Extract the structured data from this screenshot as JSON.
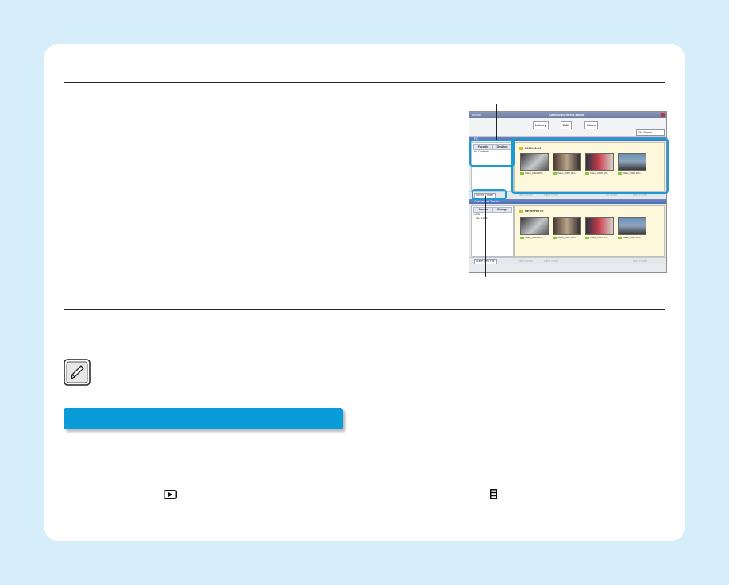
{
  "app": {
    "title_left": "MENU",
    "title_center": "SAMSUNG Intelli-studio",
    "toolbar": {
      "library_label": "Library",
      "edit_label": "Edit",
      "share_label": "Share",
      "sort_option": "File Name"
    },
    "pc_panel": {
      "header": "PC",
      "tabs": [
        "Favorite",
        "Desktop"
      ],
      "tree_item": "All Contents",
      "folder_date": "2009-01-01",
      "files": [
        "Video_0001.JPG",
        "Video_0007.JPG",
        "Video_0005.JPG",
        "Video_0002.JPG"
      ],
      "import_folder_label": "Import Folder",
      "disabled_buttons": [
        "New Album",
        "Save Photo",
        "Fit Width",
        "New Folder"
      ]
    },
    "device_panel": {
      "header": "Connected Device",
      "tabs": [
        "Device",
        "Storage"
      ],
      "tree_item_1": "USB",
      "tree_item_2": "SD Card",
      "folder": "NEWPHOTO",
      "files": [
        "Video_0001.JPG",
        "Video_0007.JPG",
        "Video_0005.JPG",
        "Video_0002.JPG"
      ],
      "save_new_file_label": "Save New File",
      "disabled_buttons": [
        "New Album",
        "Save Photo",
        "New Folder"
      ]
    }
  },
  "icons": {
    "note_icon": "pencil-note-icon",
    "play_icon": "playback-mode-icon",
    "menu_icon": "menu-list-icon"
  },
  "colors": {
    "background": "#d6eef9",
    "accent_blue": "#0a9cd9",
    "callout_blue": "#1b9ad6"
  }
}
